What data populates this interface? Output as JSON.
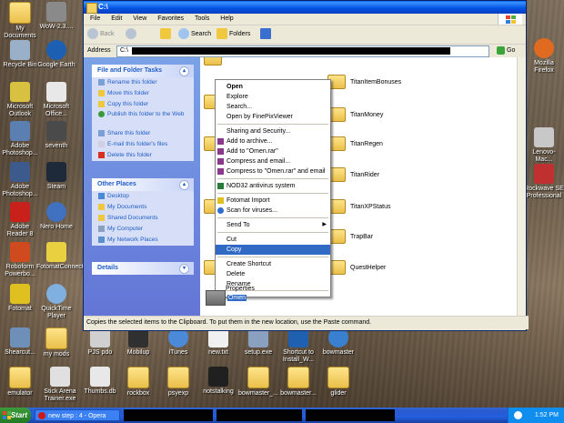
{
  "window": {
    "title": "C:\\",
    "menu": [
      "File",
      "Edit",
      "View",
      "Favorites",
      "Tools",
      "Help"
    ],
    "toolbar": {
      "back": "Back",
      "search": "Search",
      "folders": "Folders"
    },
    "address_label": "Address",
    "address_value": "C:\\",
    "go_label": "Go",
    "status_text": "Copies the selected items to the Clipboard. To put them in the new location, use the Paste command."
  },
  "tasks_panel": {
    "title": "File and Folder Tasks",
    "items": [
      "Rename this folder",
      "Move this folder",
      "Copy this folder",
      "Publish this folder to the Web",
      "Share this folder",
      "E-mail this folder's files",
      "Delete this folder"
    ]
  },
  "places_panel": {
    "title": "Other Places",
    "items": [
      "Desktop",
      "My Documents",
      "Shared Documents",
      "My Computer",
      "My Network Places"
    ]
  },
  "details_panel": {
    "title": "Details"
  },
  "folders": [
    "TitanItemBonuses",
    "TitanMoney",
    "TitanRegen",
    "TitanRider",
    "TitanXPStatus",
    "TrapBar",
    "QuestHelper"
  ],
  "selected_folder": "Omen",
  "context_menu": {
    "items": [
      {
        "label": "Open",
        "bold": true
      },
      {
        "label": "Explore"
      },
      {
        "label": "Search..."
      },
      {
        "label": "Open by FinePixViewer"
      },
      {
        "sep": true
      },
      {
        "label": "Sharing and Security..."
      },
      {
        "label": "Add to archive..."
      },
      {
        "label": "Add to \"Omen.rar\""
      },
      {
        "label": "Compress and email..."
      },
      {
        "label": "Compress to \"Omen.rar\" and email"
      },
      {
        "sep": true
      },
      {
        "label": "NOD32 antivirus system"
      },
      {
        "sep": true
      },
      {
        "label": "Fotomat Import"
      },
      {
        "label": "Scan for viruses..."
      },
      {
        "sep": true
      },
      {
        "label": "Send To",
        "submenu": true
      },
      {
        "sep": true
      },
      {
        "label": "Cut"
      },
      {
        "label": "Copy",
        "highlighted": true
      },
      {
        "sep": true
      },
      {
        "label": "Create Shortcut"
      },
      {
        "label": "Delete"
      },
      {
        "label": "Rename"
      },
      {
        "sep": true
      },
      {
        "label": "Properties"
      }
    ]
  },
  "desktop_left": [
    "My Documents",
    "Recycle Bin",
    "Microsoft Outlook",
    "Adobe Photoshop...",
    "Adobe Photoshop...",
    "Adobe Reader 8",
    "Roboform Powerbo...",
    "Fotomat",
    "Shearcut..."
  ],
  "desktop_left2": [
    "WoW-2.3....",
    "Google Earth",
    "Microsoft Office...",
    "seventh",
    "Steam",
    "Nero Home",
    "FotomatConnect",
    "QuickTime Player",
    "my mods"
  ],
  "desktop_right": [
    "Mozilla Firefox",
    "Lenovo-Mac...",
    "Rockwave SE Professional"
  ],
  "desktop_bottom_row1": [
    "PJS pdo",
    "Mobilup",
    "iTunes",
    "new.txt",
    "setup.exe",
    "Shortcut to Install_W...",
    "bowmaster"
  ],
  "desktop_bottom_row2": [
    "emulator",
    "Stick Arena Trainer.exe",
    "Thumbs.db",
    "rockbox",
    "psyexp",
    "notstalking",
    "bowmaster_...",
    "bowmaster...",
    "glider"
  ],
  "taskbar": {
    "start": "Start",
    "task": "new step : 4 - Opera",
    "clock": "1:52 PM"
  },
  "colors": {
    "selection": "#316ac5",
    "titlebar": "#0058ee",
    "taskbar": "#245edb",
    "start": "#2d8a2d"
  }
}
